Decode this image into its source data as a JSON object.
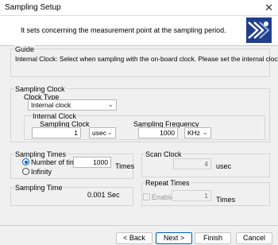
{
  "window": {
    "title": "Sampling Setup"
  },
  "header": {
    "description": "It sets concerning the measurement point at the sampling period."
  },
  "guide": {
    "label": "Guide",
    "text": "Internal Clock: Select when sampling with the on-board clock. Please set the internal clock."
  },
  "sampling_clock": {
    "label": "Sampling Clock",
    "clock_type_label": "Clock Type",
    "clock_type_value": "Internal clock",
    "internal_clock": {
      "label": "Internal Clock",
      "sampling_clock_label": "Sampling Clock",
      "sampling_clock_value": "1",
      "sampling_clock_unit": "usec",
      "sampling_frequency_label": "Sampling Frequency",
      "sampling_frequency_value": "1000",
      "sampling_frequency_unit": "KHz"
    }
  },
  "sampling_times": {
    "label": "Sampling Times",
    "number_label": "Number of times",
    "number_value": "1000",
    "number_unit": "Times",
    "infinity_label": "Infinity",
    "selected": "Number of times"
  },
  "scan_clock": {
    "label": "Scan Clock",
    "value": "4",
    "unit": "usec"
  },
  "sampling_time": {
    "label": "Sampling Time",
    "value": "0.001 Sec"
  },
  "repeat_times": {
    "label": "Repeat Times",
    "enable_label": "Enable",
    "enabled": false,
    "value": "1",
    "unit": "Times"
  },
  "footer": {
    "back_label": "< Back",
    "next_label": "Next >",
    "finish_label": "Finish",
    "cancel_label": "Cancel"
  },
  "icons": {
    "close": "close-icon",
    "logo": "wizard-logo-icon",
    "chevron": "chevron-down-icon"
  },
  "colors": {
    "accent": "#005fb8",
    "logo_blue": "#1f3f8c"
  }
}
